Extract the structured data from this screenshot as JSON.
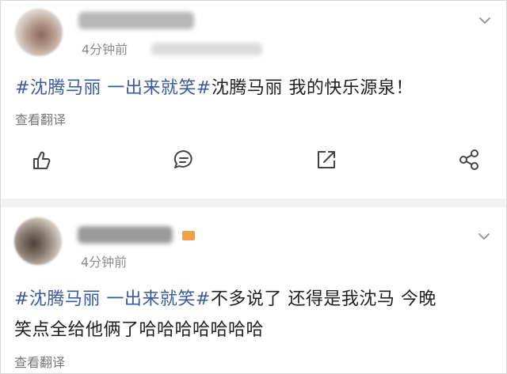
{
  "posts": [
    {
      "time": "4分钟前",
      "tag": "#沈腾马丽 一出来就笑#",
      "text": "沈腾马丽 我的快乐源泉！",
      "translate": "查看翻译"
    },
    {
      "time": "4分钟前",
      "tag": "#沈腾马丽 一出来就笑#",
      "text_line1": "不多说了 还得是我沈马 今晚",
      "text_line2": "笑点全给他俩了哈哈哈哈哈哈哈",
      "translate": "查看翻译"
    }
  ],
  "actions": {
    "icons": [
      "like-icon",
      "comment-icon",
      "repost-icon",
      "share-icon"
    ]
  },
  "colors": {
    "tag": "#3b5a9a",
    "muted": "#8c8c8c",
    "vip_badge": "#f0a24a"
  }
}
